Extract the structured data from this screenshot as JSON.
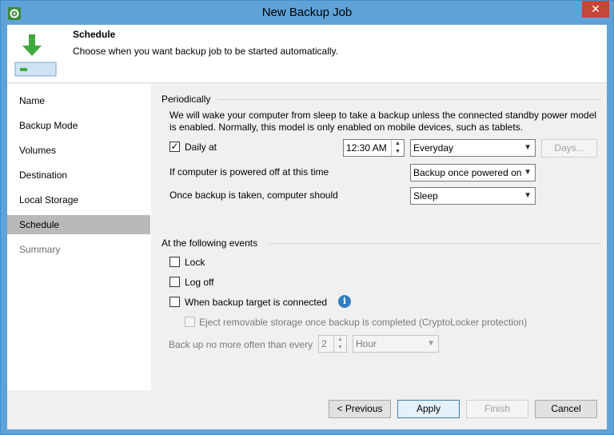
{
  "window": {
    "title": "New Backup Job",
    "close_glyph": "✕"
  },
  "header": {
    "title": "Schedule",
    "description": "Choose when you want backup job to be started automatically."
  },
  "sidebar": {
    "items": [
      {
        "label": "Name",
        "state": "normal"
      },
      {
        "label": "Backup Mode",
        "state": "normal"
      },
      {
        "label": "Volumes",
        "state": "normal"
      },
      {
        "label": "Destination",
        "state": "normal"
      },
      {
        "label": "Local Storage",
        "state": "normal"
      },
      {
        "label": "Schedule",
        "state": "selected"
      },
      {
        "label": "Summary",
        "state": "disabled"
      }
    ]
  },
  "periodically": {
    "label": "Periodically",
    "note_line1": "We will wake your computer from sleep to take a backup unless the connected standby power model",
    "note_line2": "is enabled. Normally, this model is only enabled on mobile devices, such as tablets.",
    "daily": {
      "label": "Daily at",
      "checked": true,
      "time": "12:30 AM",
      "frequency": "Everyday",
      "days_button": "Days..."
    },
    "powered_off": {
      "label": "If computer is powered off at this time",
      "value": "Backup once powered on"
    },
    "after_backup": {
      "label": "Once backup is taken, computer should",
      "value": "Sleep"
    }
  },
  "events": {
    "label": "At the following events",
    "lock": {
      "label": "Lock",
      "checked": false
    },
    "logoff": {
      "label": "Log off",
      "checked": false
    },
    "target_connected": {
      "label": "When backup target is connected",
      "checked": false
    },
    "eject": {
      "label": "Eject removable storage once backup is completed (CryptoLocker protection)",
      "checked": false
    },
    "often": {
      "label": "Back up no more often than every",
      "count": "2",
      "unit": "Hour"
    }
  },
  "footer": {
    "previous": "< Previous",
    "apply": "Apply",
    "finish": "Finish",
    "cancel": "Cancel"
  },
  "icons": {
    "app": "gear-icon",
    "info": "info-icon",
    "header": "download-to-disk-icon"
  },
  "colors": {
    "title_bar": "#5fa2d7",
    "close_button": "#c7463a",
    "header_arrow": "#3faa3f",
    "selected_nav": "#b9b9b9",
    "info_icon": "#2f7fc1"
  }
}
